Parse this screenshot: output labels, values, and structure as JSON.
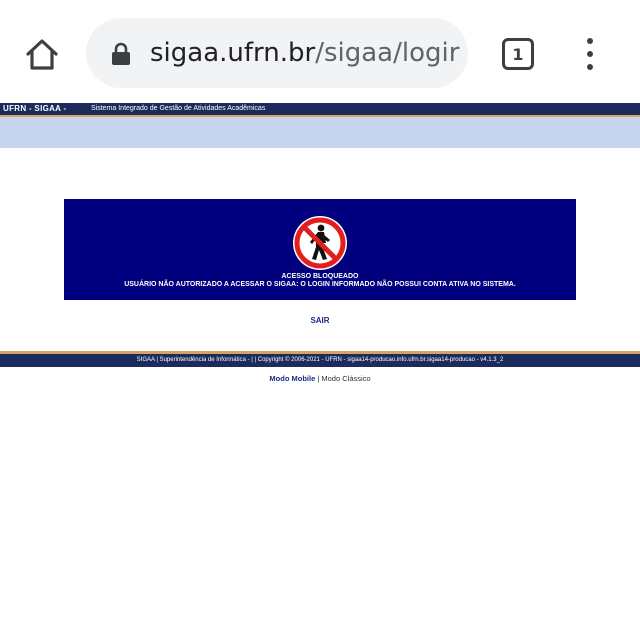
{
  "browser": {
    "url_host": "sigaa.ufrn.br",
    "url_path": "/sigaa/logir",
    "tab_count": "1",
    "icons": {
      "home": "home-icon",
      "lock": "lock-icon",
      "tabs": "tab-switcher-icon",
      "menu": "more-vert-icon"
    }
  },
  "header": {
    "system_name": "UFRN - SIGAA -",
    "system_description": "Sistema Integrado de Gestão de Atividades Acadêmicas"
  },
  "alert": {
    "icon": "no-entry-pedestrian-icon",
    "title": "ACESSO BLOQUEADO",
    "message": "USUÁRIO NÃO AUTORIZADO A ACESSAR O SIGAA: O LOGIN INFORMADO NÃO POSSUI CONTA ATIVA NO SISTEMA."
  },
  "actions": {
    "exit_label": "SAIR"
  },
  "footer": {
    "text": "SIGAA | Superintendência de Informática - | | Copyright © 2006-2021 - UFRN - sigaa14-producao.info.ufrn.br.sigaa14-producao - v4.1.3_2",
    "mode_mobile": "Modo Mobile",
    "separator": "|",
    "mode_classic": "Modo Clássico"
  },
  "colors": {
    "header_navy": "#1b2c5c",
    "accent_orange": "#d8a266",
    "light_blue_strip": "#c6d4ee",
    "alert_background": "#00007f",
    "link_blue": "#1b2c8a",
    "no_entry_red": "#e02020"
  }
}
